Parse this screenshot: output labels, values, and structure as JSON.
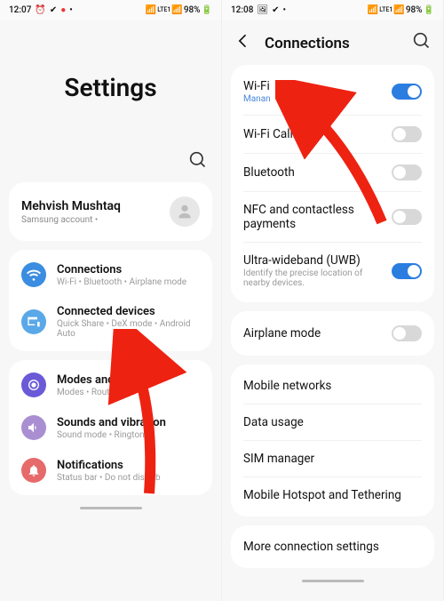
{
  "left": {
    "status": {
      "time": "12:07",
      "battery": "98%",
      "net": "LTE1"
    },
    "title": "Settings",
    "account": {
      "name": "Mehvish Mushtaq",
      "sub": "Samsung account  •"
    },
    "items": [
      {
        "label": "Connections",
        "sub": "Wi-Fi • Bluetooth • Airplane mode"
      },
      {
        "label": "Connected devices",
        "sub": "Quick Share • DeX mode • Android Auto"
      },
      {
        "label": "Modes and Routines",
        "sub": "Modes • Routines"
      },
      {
        "label": "Sounds and vibration",
        "sub": "Sound mode • Ringtone"
      },
      {
        "label": "Notifications",
        "sub": "Status bar • Do not disturb"
      }
    ]
  },
  "right": {
    "status": {
      "time": "12:08",
      "battery": "98%",
      "net": "LTE1"
    },
    "title": "Connections",
    "group1": [
      {
        "label": "Wi-Fi",
        "sub": "Manan",
        "subClass": "blue",
        "on": true
      },
      {
        "label": "Wi-Fi Calling",
        "on": false
      },
      {
        "label": "Bluetooth",
        "on": false
      },
      {
        "label": "NFC and contactless payments",
        "on": false
      },
      {
        "label": "Ultra-wideband (UWB)",
        "sub": "Identify the precise location of nearby devices.",
        "subClass": "gray",
        "on": true
      }
    ],
    "group2": [
      {
        "label": "Airplane mode",
        "on": false
      }
    ],
    "group3": [
      {
        "label": "Mobile networks"
      },
      {
        "label": "Data usage"
      },
      {
        "label": "SIM manager"
      },
      {
        "label": "Mobile Hotspot and Tethering"
      }
    ],
    "group4": [
      {
        "label": "More connection settings"
      }
    ]
  }
}
